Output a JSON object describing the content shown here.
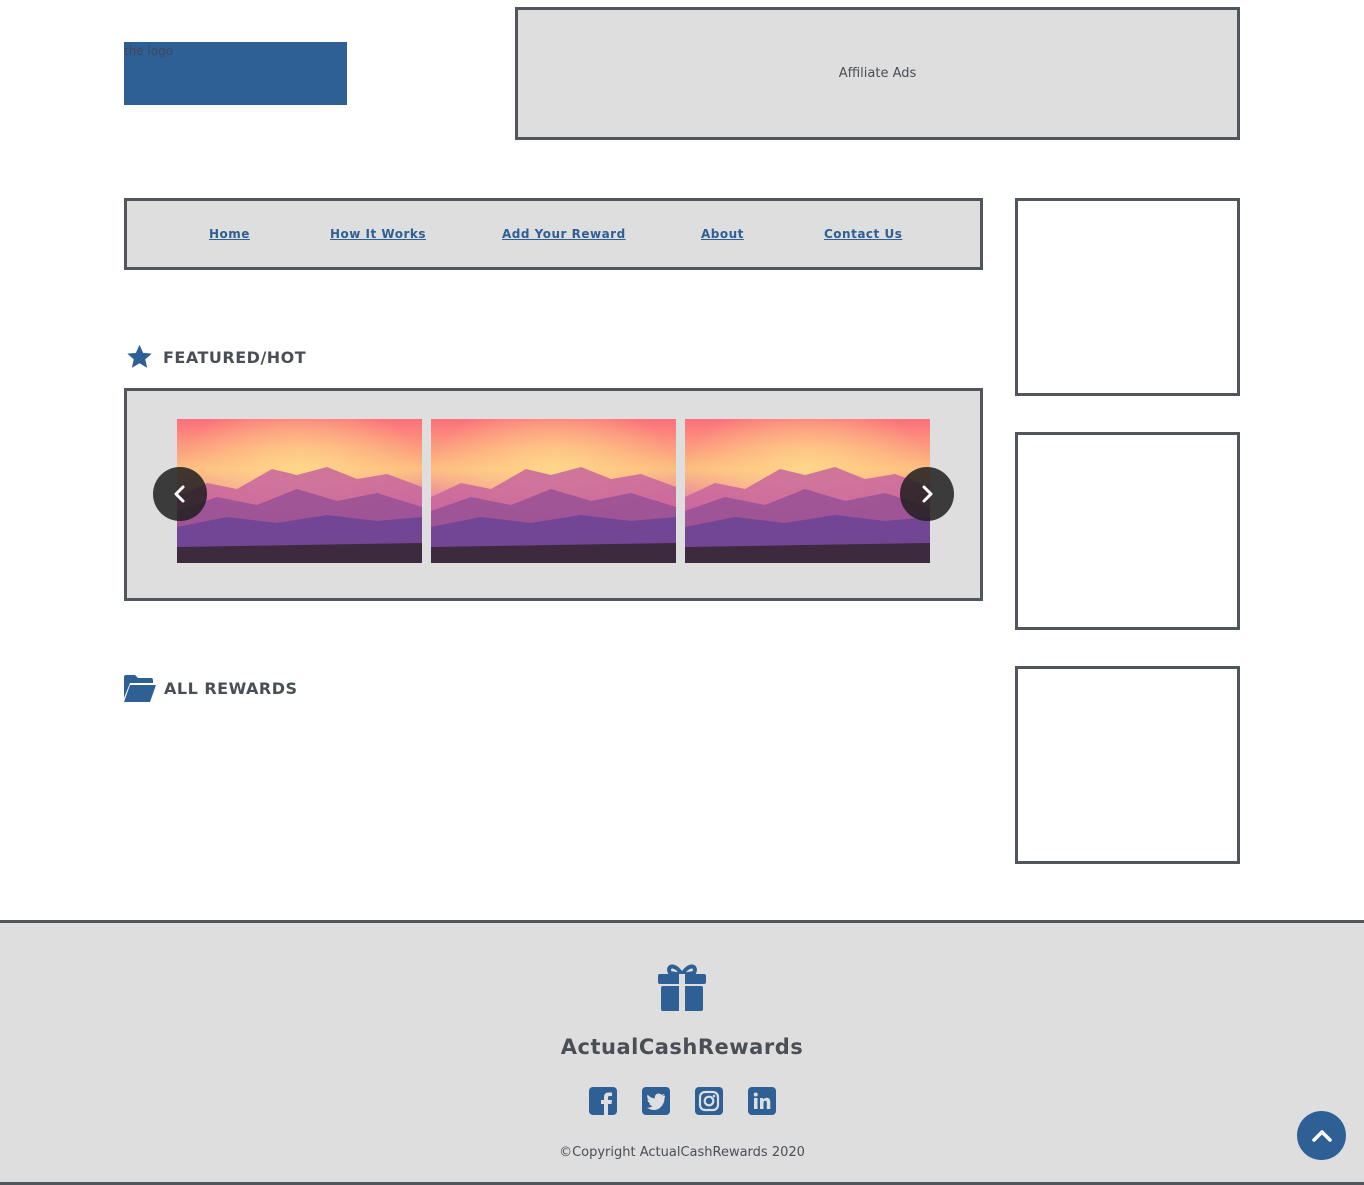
{
  "header": {
    "logo_alt": "the logo",
    "affiliate_ads": "Affiliate Ads"
  },
  "nav": {
    "items": [
      {
        "label": "Home"
      },
      {
        "label": "How It Works"
      },
      {
        "label": "Add Your Reward"
      },
      {
        "label": "About"
      },
      {
        "label": "Contact Us"
      }
    ]
  },
  "featured": {
    "title": "FEATURED/HOT",
    "icon": "star-icon",
    "slide_count": 3
  },
  "all_rewards": {
    "title": "ALL REWARDS",
    "icon": "folder-icon"
  },
  "footer": {
    "icon": "gift-icon",
    "brand": "ActualCashRewards",
    "socials": [
      "facebook-icon",
      "twitter-icon",
      "instagram-icon",
      "linkedin-icon"
    ],
    "copyright": "©Copyright ActualCashRewards 2020"
  },
  "colors": {
    "accent": "#2e6096",
    "border": "#50565c",
    "panel": "#dedede",
    "text": "#4a4f55"
  }
}
